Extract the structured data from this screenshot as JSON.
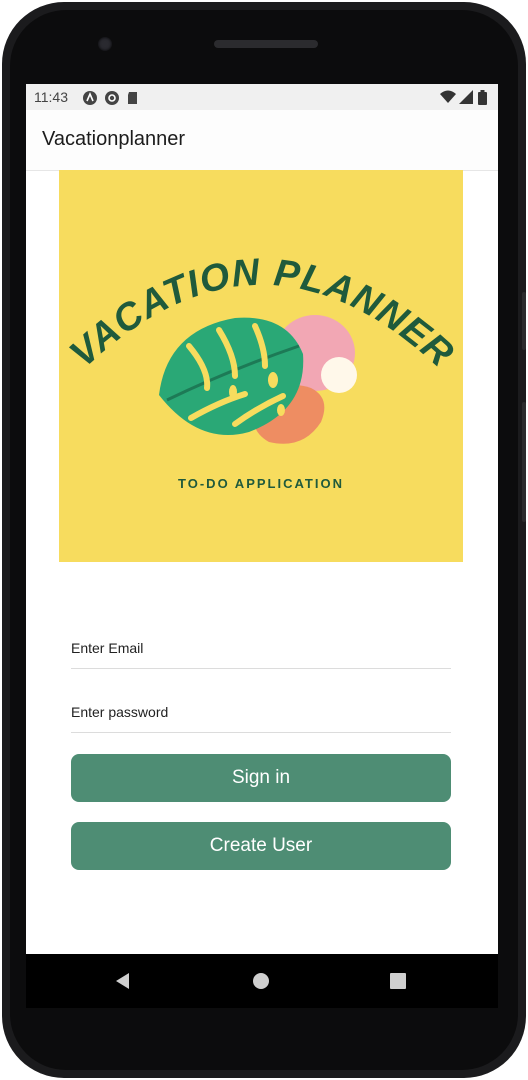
{
  "status_bar": {
    "time": "11:43",
    "icons": [
      "android-studio-icon",
      "sync-icon",
      "sd-card-icon",
      "wifi-icon",
      "signal-icon",
      "battery-icon"
    ]
  },
  "app_bar": {
    "title": "Vacationplanner"
  },
  "banner": {
    "heading": "VACATION PLANNER",
    "subtitle": "TO-DO APPLICATION",
    "background_color": "#f7dc5e",
    "leaf_color": "#2aa876",
    "text_color": "#1f5a3c"
  },
  "form": {
    "email_placeholder": "Enter Email",
    "password_placeholder": "Enter password",
    "sign_in_label": "Sign in",
    "create_user_label": "Create User",
    "button_color": "#4e8d74"
  },
  "nav_bar": {
    "buttons": [
      "back-icon",
      "home-icon",
      "recents-icon"
    ]
  }
}
